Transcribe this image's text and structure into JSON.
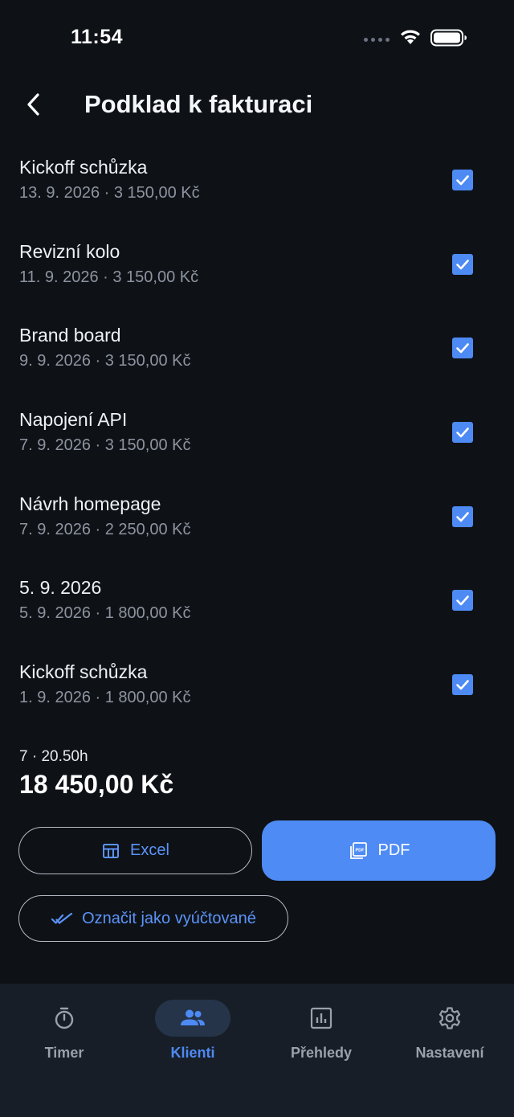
{
  "status": {
    "time": "11:54"
  },
  "header": {
    "title": "Podklad k fakturaci"
  },
  "items": [
    {
      "title": "Kickoff schůzka",
      "meta": "13. 9. 2026 · 3 150,00 Kč",
      "checked": true
    },
    {
      "title": "Revizní kolo",
      "meta": "11. 9. 2026 · 3 150,00 Kč",
      "checked": true
    },
    {
      "title": "Brand board",
      "meta": "9. 9. 2026 · 3 150,00 Kč",
      "checked": true
    },
    {
      "title": "Napojení API",
      "meta": "7. 9. 2026 · 3 150,00 Kč",
      "checked": true
    },
    {
      "title": "Návrh homepage",
      "meta": "7. 9. 2026 · 2 250,00 Kč",
      "checked": true
    },
    {
      "title": "5. 9. 2026",
      "meta": "5. 9. 2026 · 1 800,00 Kč",
      "checked": true
    },
    {
      "title": "Kickoff schůzka",
      "meta": "1. 9. 2026 · 1 800,00 Kč",
      "checked": true
    }
  ],
  "summary": {
    "count": "7 · 20.50h",
    "total": "18 450,00 Kč"
  },
  "actions": {
    "excel_label": "Excel",
    "pdf_label": "PDF",
    "mark_label": "Označit jako vyúčtované"
  },
  "nav": {
    "items": [
      {
        "label": "Timer",
        "icon": "stopwatch-icon",
        "active": false
      },
      {
        "label": "Klienti",
        "icon": "people-icon",
        "active": true
      },
      {
        "label": "Přehledy",
        "icon": "chart-icon",
        "active": false
      },
      {
        "label": "Nastavení",
        "icon": "gear-icon",
        "active": false
      }
    ]
  },
  "colors": {
    "accent": "#4d8af4",
    "background": "#0e1217",
    "nav_background": "#181e27"
  }
}
